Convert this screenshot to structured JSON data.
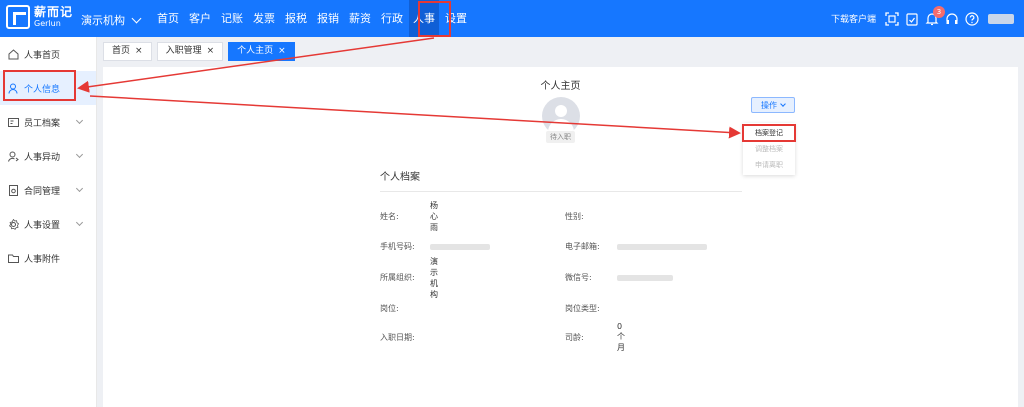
{
  "header": {
    "logo_cn": "薪而记",
    "logo_en": "Gerlun",
    "org_name": "演示机构",
    "nav": [
      "首页",
      "客户",
      "记账",
      "发票",
      "报税",
      "报销",
      "薪资",
      "行政",
      "人事",
      "设置"
    ],
    "active_nav": "人事",
    "download_label": "下载客户端",
    "notification_count": "3"
  },
  "sidebar": {
    "items": [
      {
        "label": "人事首页",
        "icon": "home-icon"
      },
      {
        "label": "个人信息",
        "icon": "user-icon"
      },
      {
        "label": "员工档案",
        "icon": "id-card-icon"
      },
      {
        "label": "人事异动",
        "icon": "user-switch-icon"
      },
      {
        "label": "合同管理",
        "icon": "contract-icon"
      },
      {
        "label": "人事设置",
        "icon": "gear-icon"
      },
      {
        "label": "人事附件",
        "icon": "folder-icon"
      }
    ]
  },
  "tabs": [
    {
      "label": "首页"
    },
    {
      "label": "入职管理"
    },
    {
      "label": "个人主页"
    }
  ],
  "main": {
    "page_title": "个人主页",
    "status": "待入职",
    "action_label": "操作",
    "dropdown": [
      {
        "label": "档案登记"
      },
      {
        "label": "调整档案"
      },
      {
        "label": "申请离职"
      }
    ],
    "section_title": "个人档案",
    "fields": {
      "name_label": "姓名:",
      "name_value": "杨心雨",
      "gender_label": "性别:",
      "phone_label": "手机号码:",
      "email_label": "电子邮箱:",
      "org_label": "所属组织:",
      "org_value": "演示机构",
      "wechat_label": "微信号:",
      "post_label": "岗位:",
      "post_type_label": "岗位类型:",
      "hire_date_label": "入职日期:",
      "tenure_label": "司龄:",
      "tenure_value": "0个月"
    }
  },
  "colors": {
    "brand": "#1677ff",
    "annotation": "#e53935"
  }
}
